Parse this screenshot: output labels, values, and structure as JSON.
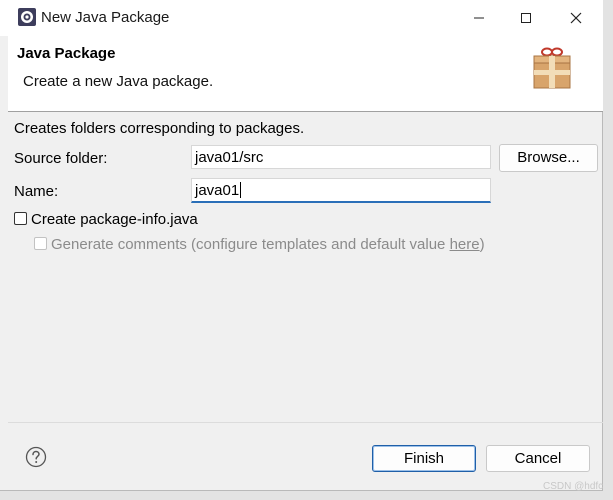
{
  "window": {
    "title": "New Java Package",
    "icons": {
      "app": "eclipse-icon",
      "minimize": "minimize-icon",
      "maximize": "maximize-icon",
      "close": "close-icon"
    }
  },
  "banner": {
    "title": "Java Package",
    "description": "Create a new Java package.",
    "image": "package-wizard-icon"
  },
  "form": {
    "info": "Creates folders corresponding to packages.",
    "source_folder_label": "Source folder:",
    "source_folder_value": "java01/src",
    "browse_label": "Browse...",
    "name_label": "Name:",
    "name_value": "java01",
    "create_package_info_label": "Create package-info.java",
    "create_package_info_checked": false,
    "generate_comments_prefix": "Generate comments (configure templates and default value ",
    "generate_comments_link": "here",
    "generate_comments_suffix": ")",
    "generate_comments_checked": false,
    "generate_comments_enabled": false
  },
  "buttons": {
    "help_icon": "help-icon",
    "finish_label": "Finish",
    "cancel_label": "Cancel"
  },
  "watermark": "CSDN @hdfc"
}
